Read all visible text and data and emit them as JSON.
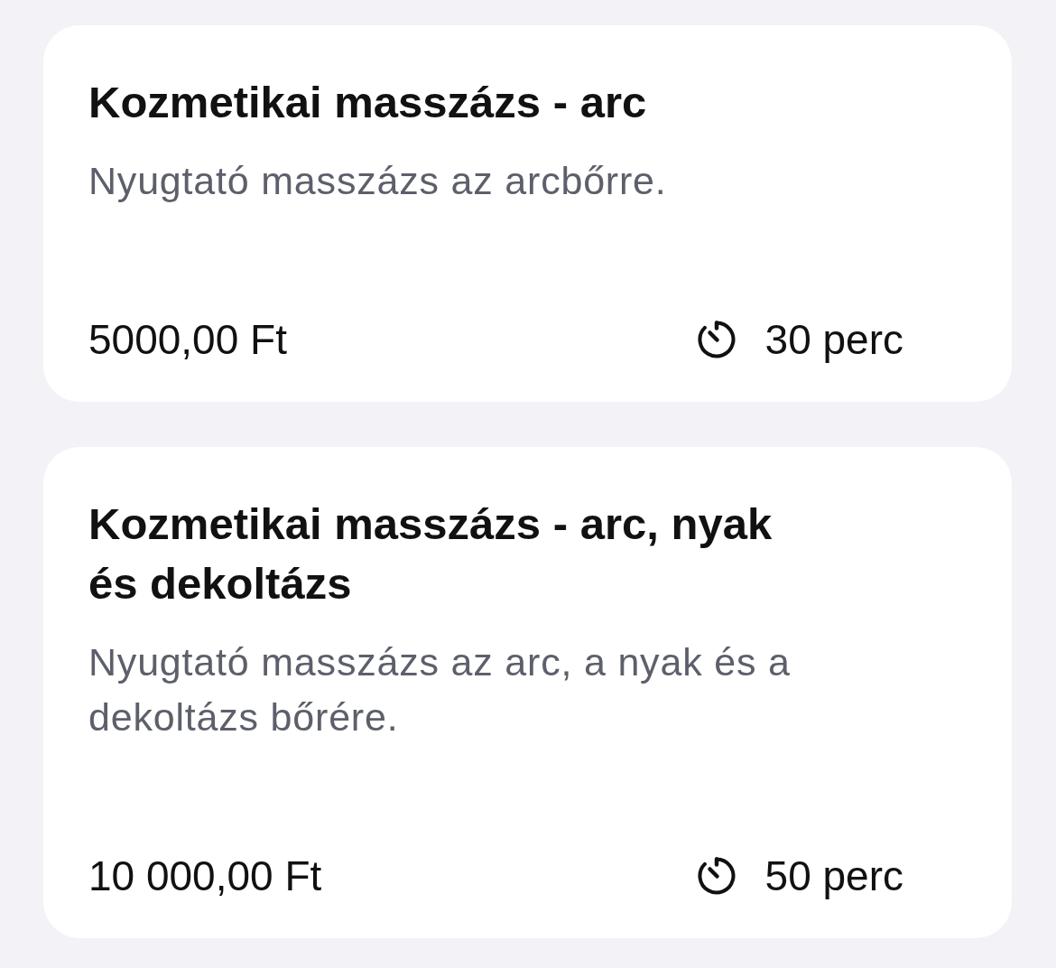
{
  "services": [
    {
      "title": "Kozmetikai masszázs - arc",
      "description": "Nyugtató masszázs az arcbőrre.",
      "price": "5000,00 Ft",
      "duration": "30 perc"
    },
    {
      "title": "Kozmetikai masszázs - arc, nyak és dekoltázs",
      "description": "Nyugtató masszázs az arc, a nyak és a dekoltázs bőrére.",
      "price": "10 000,00 Ft",
      "duration": "50 perc"
    }
  ]
}
